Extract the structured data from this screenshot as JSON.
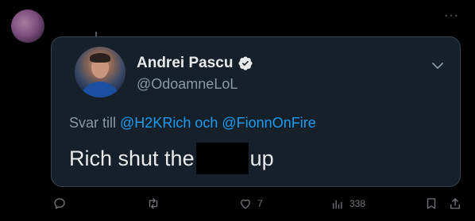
{
  "colors": {
    "background": "#000000",
    "card_background": "#15202b",
    "card_border": "#38444d",
    "primary_text": "#e7e9ea",
    "secondary_text": "#8b98a5",
    "link": "#1d9bf0",
    "icon_gray": "#71767b"
  },
  "tweet": {
    "more_icon": "more-horizontal-icon"
  },
  "quoted": {
    "display_name": "Andrei Pascu",
    "verified": true,
    "handle": "@OdoamneLoL",
    "reply_prefix": "Svar till",
    "mention_1": "@H2KRich",
    "conjunction": "och",
    "mention_2": "@FionnOnFire",
    "text_before": "Rich shut the",
    "text_after": "up"
  },
  "actions": {
    "reply_count": "",
    "retweet_count": "",
    "like_count": "7",
    "views_count": "338"
  }
}
